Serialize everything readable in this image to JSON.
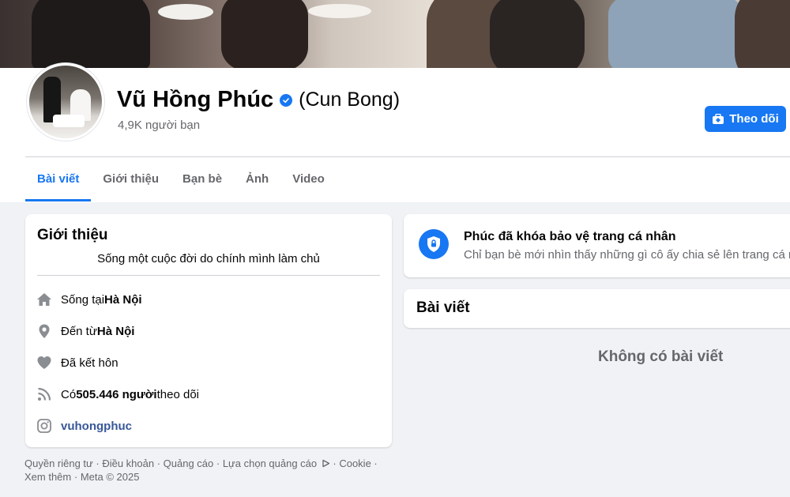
{
  "profile": {
    "name": "Vũ Hồng Phúc",
    "nickname": "(Cun Bong)",
    "friends_count": "4,9K người bạn",
    "follow_label": "Theo dõi"
  },
  "tabs": [
    {
      "label": "Bài viết",
      "active": true
    },
    {
      "label": "Giới thiệu",
      "active": false
    },
    {
      "label": "Bạn bè",
      "active": false
    },
    {
      "label": "Ảnh",
      "active": false
    },
    {
      "label": "Video",
      "active": false
    }
  ],
  "intro": {
    "title": "Giới thiệu",
    "bio": "Sống một cuộc đời do chính mình làm chủ",
    "items": [
      {
        "icon": "home-icon",
        "prefix": "Sống tại ",
        "bold": "Hà Nội",
        "suffix": ""
      },
      {
        "icon": "location-pin-icon",
        "prefix": "Đến từ ",
        "bold": "Hà Nội",
        "suffix": ""
      },
      {
        "icon": "heart-icon",
        "prefix": "Đã kết hôn",
        "bold": "",
        "suffix": ""
      },
      {
        "icon": "rss-icon",
        "prefix": "Có ",
        "bold": "505.446 người",
        "suffix": " theo dõi"
      },
      {
        "icon": "instagram-icon",
        "link": "vuhongphuc"
      }
    ]
  },
  "footer": {
    "privacy": "Quyền riêng tư",
    "terms": "Điều khoản",
    "ads": "Quảng cáo",
    "ad_choices": "Lựa chọn quảng cáo",
    "cookie": "Cookie",
    "more": "Xem thêm",
    "meta": "Meta © 2025",
    "separator": " · "
  },
  "locked": {
    "title": "Phúc đã khóa bảo vệ trang cá nhân",
    "description": "Chỉ bạn bè mới nhìn thấy những gì cô ấy chia sẻ lên trang cá nhân."
  },
  "posts": {
    "title": "Bài viết",
    "empty": "Không có bài viết"
  },
  "colors": {
    "accent": "#1877f2",
    "background": "#f0f2f5",
    "secondary_text": "#65676b",
    "link": "#385898"
  }
}
